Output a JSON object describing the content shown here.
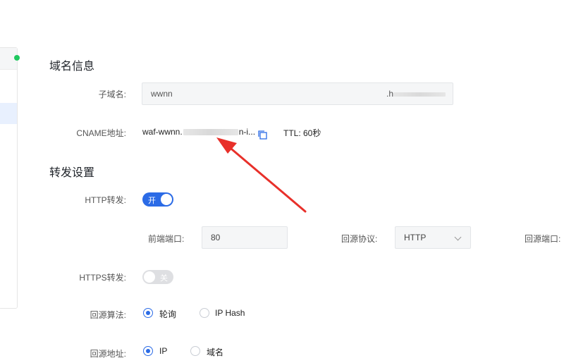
{
  "domain_info": {
    "title": "域名信息",
    "subdomain_label": "子域名:",
    "subdomain_value": "wwnn",
    "subdomain_suffix": ".h",
    "cname_label": "CNAME地址:",
    "cname_value_start": "waf-wwnn.",
    "cname_value_end": "n-i...",
    "ttl_text": "TTL: 60秒"
  },
  "forwarding": {
    "title": "转发设置",
    "http_label": "HTTP转发:",
    "http_toggle": "开",
    "frontend_port_label": "前端端口:",
    "frontend_port_value": "80",
    "origin_protocol_label": "回源协议:",
    "origin_protocol_value": "HTTP",
    "origin_port_label": "回源端口:",
    "https_label": "HTTPS转发:",
    "https_toggle": "关",
    "algorithm_label": "回源算法:",
    "algorithm_options": [
      "轮询",
      "IP Hash"
    ],
    "address_label": "回源地址:",
    "address_options": [
      "IP",
      "域名"
    ]
  },
  "colors": {
    "accent": "#2b6be6",
    "arrow": "#e8302a"
  }
}
